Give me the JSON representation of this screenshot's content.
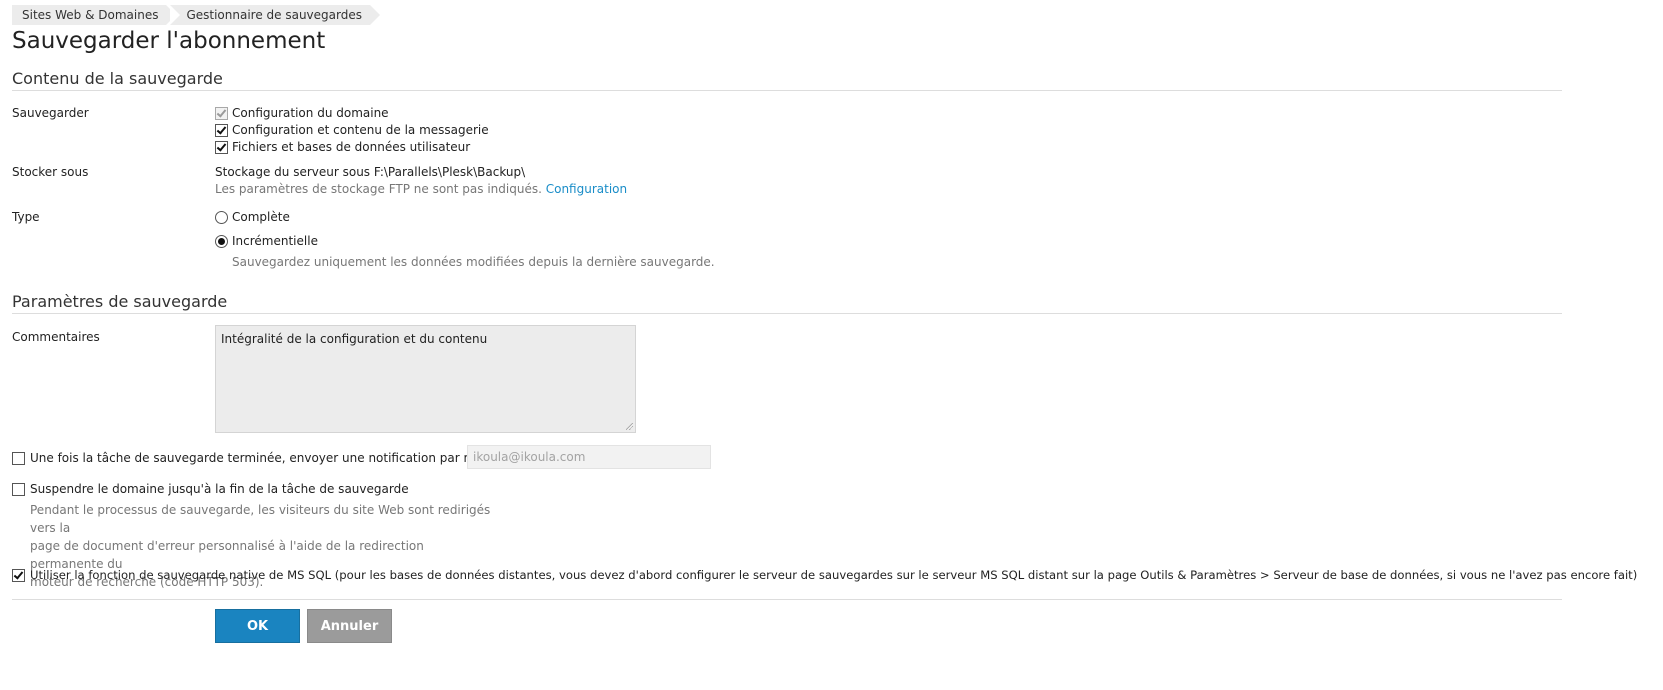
{
  "breadcrumb": [
    "Sites Web & Domaines",
    "Gestionnaire de sauvegardes"
  ],
  "page_title": "Sauvegarder l'abonnement",
  "content_section": {
    "title": "Contenu de la sauvegarde",
    "backup_label": "Sauvegarder",
    "backup_items": [
      {
        "label": "Configuration du domaine",
        "checked": true,
        "disabled": true
      },
      {
        "label": "Configuration et contenu de la messagerie",
        "checked": true,
        "disabled": false
      },
      {
        "label": "Fichiers et bases de données utilisateur",
        "checked": true,
        "disabled": false
      }
    ],
    "store_label": "Stocker sous",
    "store_value": "Stockage du serveur sous F:\\Parallels\\Plesk\\Backup\\",
    "ftp_note": "Les paramètres de stockage FTP ne sont pas indiqués.",
    "ftp_link": "Configuration",
    "type_label": "Type",
    "type_options": [
      {
        "label": "Complète",
        "selected": false
      },
      {
        "label": "Incrémentielle",
        "selected": true
      }
    ],
    "incremental_hint": "Sauvegardez uniquement les données modifiées depuis la dernière sauvegarde."
  },
  "params_section": {
    "title": "Paramètres de sauvegarde",
    "comments_label": "Commentaires",
    "comments_value": "Intégralité de la configuration et du contenu",
    "notify_label": "Une fois la tâche de sauvegarde terminée, envoyer une notification par mail à",
    "notify_checked": false,
    "notify_email_placeholder": "ikoula@ikoula.com",
    "suspend_label": "Suspendre le domaine jusqu'à la fin de la tâche de sauvegarde",
    "suspend_checked": false,
    "suspend_hint_lines": [
      "Pendant le processus de sauvegarde, les visiteurs du site Web sont redirigés vers la",
      "page de document d'erreur personnalisé à l'aide de la redirection permanente du",
      "moteur de recherche (code HTTP 503)."
    ],
    "mssql_label": "Utiliser la fonction de sauvegarde native de MS SQL (pour les bases de données distantes, vous devez d'abord configurer le serveur de sauvegardes sur le serveur MS SQL distant sur la page Outils & Paramètres > Serveur de base de données, si vous ne l'avez pas encore fait)",
    "mssql_checked": true
  },
  "buttons": {
    "ok": "OK",
    "cancel": "Annuler"
  },
  "colors": {
    "link": "#1a8dc8",
    "ok_button": "#1a84c0",
    "cancel_button": "#9b9b9b"
  }
}
